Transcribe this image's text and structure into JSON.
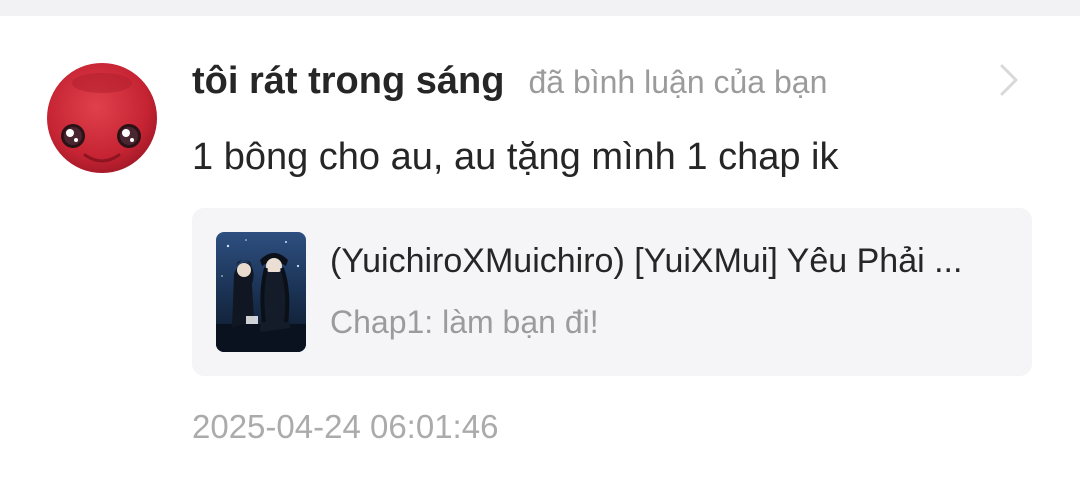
{
  "notification": {
    "username": "tôi rát trong sáng",
    "action": "đã bình luận của bạn",
    "comment": "1 bông cho au, au tặng mình 1 chap ik",
    "timestamp": "2025-04-24 06:01:46",
    "avatar_icon": "red-mascot-avatar",
    "chevron_icon": "chevron-right-icon"
  },
  "story": {
    "title": "(YuichiroXMuichiro) [YuiXMui] Yêu Phải ...",
    "chapter": "Chap1: làm bạn đi!",
    "cover_icon": "anime-cover-thumbnail"
  },
  "colors": {
    "page_background": "#f2f2f4",
    "card_background": "#ffffff",
    "primary_text": "#262626",
    "secondary_text": "#9b9b9b",
    "story_card_background": "#f5f5f7",
    "avatar_red": "#c62433"
  }
}
